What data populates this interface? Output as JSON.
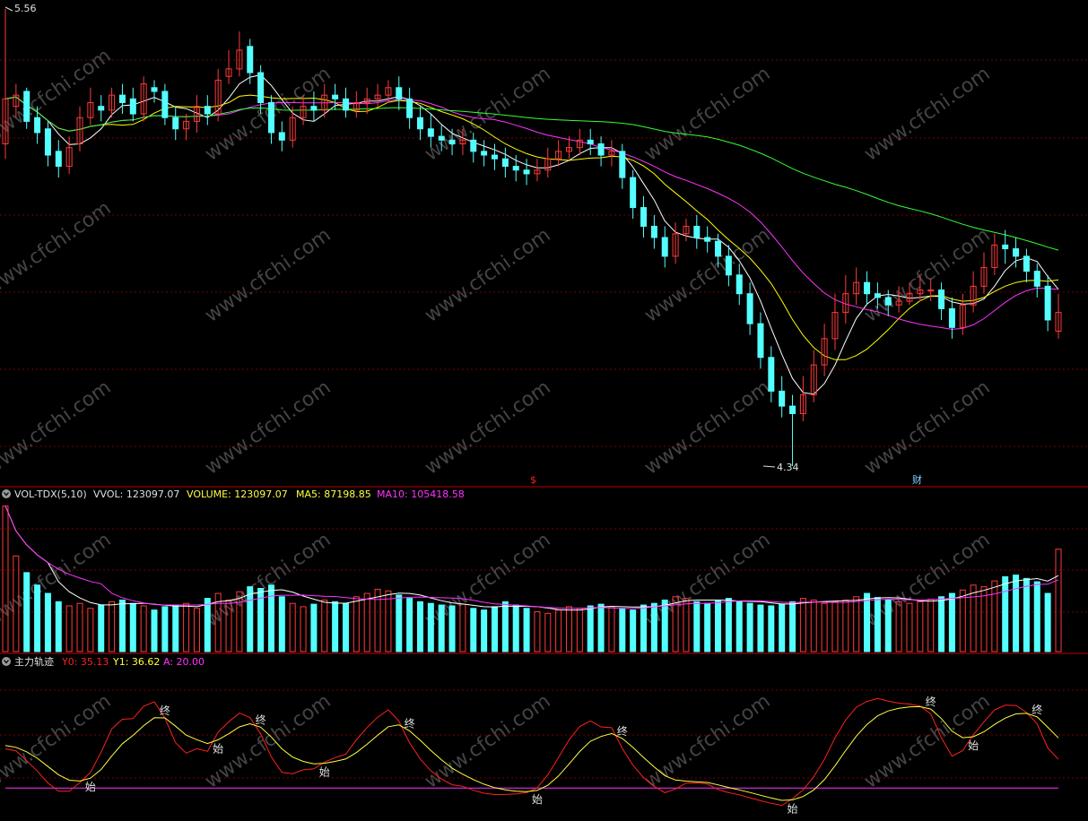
{
  "colors": {
    "up": "#ff3a3a",
    "down": "#54ffff",
    "ma_short": "#ffffff",
    "ma_mid": "#ffff00",
    "ma_long": "#ff33ff",
    "ma_slow": "#33ff33",
    "grid": "#7a0000",
    "separator": "#c00000",
    "vol_ma5": "#ffffff",
    "vol_ma10": "#ff33ff",
    "y0": "#ff2020",
    "y1": "#ffff40",
    "a_line": "#ff33ff",
    "text_white": "#e0e0e0",
    "text_yellow": "#ffff40",
    "text_magenta": "#ff33ff",
    "text_red": "#ff2020",
    "watermark": "#444444"
  },
  "watermark_text": "www.cfchi.com",
  "price_panel": {
    "high_marker": "5.56",
    "low_marker": "4.34",
    "event_s": "$",
    "event_cai": "财"
  },
  "volume_panel": {
    "name": "VOL-TDX(5,10)",
    "vvol": "VVOL: 123097.07",
    "volume": "VOLUME: 123097.07",
    "ma5": "MA5: 87198.85",
    "ma10": "MA10: 105418.58"
  },
  "indicator_panel": {
    "name": "主力轨迹",
    "y0": "Y0: 35.13",
    "y1": "Y1: 36.62",
    "a": "A: 20.00",
    "start_label": "始",
    "end_label": "终"
  },
  "chart_data": [
    {
      "type": "candlestick",
      "ylim": [
        4.34,
        5.56
      ],
      "description_keys": [
        "count",
        "open",
        "high",
        "low",
        "close"
      ],
      "count": 100,
      "close": [
        5.32,
        5.33,
        5.26,
        5.23,
        5.17,
        5.14,
        5.19,
        5.27,
        5.31,
        5.29,
        5.33,
        5.31,
        5.28,
        5.36,
        5.34,
        5.27,
        5.24,
        5.26,
        5.3,
        5.28,
        5.37,
        5.4,
        5.45,
        5.39,
        5.31,
        5.23,
        5.21,
        5.27,
        5.3,
        5.29,
        5.33,
        5.32,
        5.29,
        5.31,
        5.32,
        5.33,
        5.35,
        5.32,
        5.27,
        5.24,
        5.22,
        5.21,
        5.2,
        5.21,
        5.18,
        5.17,
        5.16,
        5.14,
        5.13,
        5.12,
        5.13,
        5.16,
        5.18,
        5.19,
        5.21,
        5.2,
        5.17,
        5.18,
        5.11,
        5.03,
        4.98,
        4.95,
        4.9,
        4.96,
        4.98,
        4.95,
        4.94,
        4.9,
        4.85,
        4.8,
        4.72,
        4.63,
        4.54,
        4.5,
        4.48,
        4.53,
        4.61,
        4.68,
        4.75,
        4.8,
        4.83,
        4.8,
        4.79,
        4.77,
        4.78,
        4.8,
        4.81,
        4.81,
        4.76,
        4.71,
        4.77,
        4.82,
        4.87,
        4.93,
        4.92,
        4.9,
        4.86,
        4.82,
        4.73,
        4.75
      ],
      "open": [
        5.2,
        5.3,
        5.34,
        5.27,
        5.24,
        5.18,
        5.14,
        5.2,
        5.27,
        5.3,
        5.29,
        5.33,
        5.32,
        5.28,
        5.35,
        5.34,
        5.27,
        5.24,
        5.26,
        5.3,
        5.28,
        5.38,
        5.4,
        5.46,
        5.39,
        5.31,
        5.23,
        5.21,
        5.27,
        5.3,
        5.29,
        5.33,
        5.32,
        5.29,
        5.31,
        5.32,
        5.33,
        5.35,
        5.32,
        5.27,
        5.24,
        5.22,
        5.21,
        5.2,
        5.21,
        5.18,
        5.17,
        5.16,
        5.14,
        5.13,
        5.12,
        5.13,
        5.16,
        5.18,
        5.19,
        5.21,
        5.2,
        5.17,
        5.18,
        5.11,
        5.03,
        4.98,
        4.95,
        4.9,
        4.96,
        4.98,
        4.95,
        4.94,
        4.9,
        4.85,
        4.8,
        4.72,
        4.63,
        4.54,
        4.5,
        4.48,
        4.53,
        4.61,
        4.68,
        4.75,
        4.8,
        4.83,
        4.8,
        4.79,
        4.77,
        4.78,
        4.8,
        4.81,
        4.81,
        4.76,
        4.71,
        4.77,
        4.82,
        4.87,
        4.93,
        4.92,
        4.9,
        4.86,
        4.82,
        4.7
      ],
      "high": [
        5.56,
        5.36,
        5.35,
        5.3,
        5.26,
        5.21,
        5.22,
        5.3,
        5.35,
        5.33,
        5.35,
        5.36,
        5.35,
        5.38,
        5.37,
        5.36,
        5.3,
        5.28,
        5.33,
        5.33,
        5.4,
        5.45,
        5.5,
        5.48,
        5.41,
        5.33,
        5.26,
        5.3,
        5.33,
        5.34,
        5.36,
        5.36,
        5.35,
        5.34,
        5.35,
        5.36,
        5.37,
        5.38,
        5.35,
        5.3,
        5.28,
        5.25,
        5.24,
        5.24,
        5.23,
        5.21,
        5.2,
        5.19,
        5.17,
        5.16,
        5.16,
        5.19,
        5.21,
        5.22,
        5.24,
        5.24,
        5.22,
        5.21,
        5.2,
        5.13,
        5.06,
        5.01,
        4.98,
        4.99,
        5.0,
        5.01,
        4.98,
        4.96,
        4.93,
        4.88,
        4.83,
        4.75,
        4.66,
        4.58,
        4.53,
        4.58,
        4.65,
        4.72,
        4.8,
        4.85,
        4.87,
        4.86,
        4.83,
        4.81,
        4.82,
        4.83,
        4.85,
        4.84,
        4.83,
        4.79,
        4.8,
        4.86,
        4.91,
        4.96,
        4.97,
        4.95,
        4.92,
        4.88,
        4.85,
        4.8
      ],
      "low": [
        5.16,
        5.27,
        5.24,
        5.2,
        5.14,
        5.11,
        5.12,
        5.18,
        5.25,
        5.26,
        5.27,
        5.28,
        5.26,
        5.26,
        5.31,
        5.25,
        5.21,
        5.21,
        5.23,
        5.25,
        5.26,
        5.36,
        5.38,
        5.36,
        5.28,
        5.2,
        5.18,
        5.19,
        5.25,
        5.26,
        5.27,
        5.29,
        5.27,
        5.27,
        5.28,
        5.3,
        5.31,
        5.29,
        5.24,
        5.21,
        5.19,
        5.18,
        5.17,
        5.17,
        5.15,
        5.14,
        5.13,
        5.11,
        5.1,
        5.09,
        5.1,
        5.11,
        5.14,
        5.16,
        5.17,
        5.17,
        5.14,
        5.14,
        5.08,
        5.0,
        4.95,
        4.92,
        4.87,
        4.88,
        4.94,
        4.92,
        4.91,
        4.87,
        4.82,
        4.77,
        4.69,
        4.6,
        4.51,
        4.47,
        4.34,
        4.46,
        4.51,
        4.58,
        4.65,
        4.72,
        4.77,
        4.77,
        4.76,
        4.74,
        4.75,
        4.77,
        4.78,
        4.78,
        4.73,
        4.68,
        4.69,
        4.75,
        4.8,
        4.85,
        4.88,
        4.87,
        4.83,
        4.79,
        4.7,
        4.68
      ]
    },
    {
      "type": "bar",
      "name": "VOLUME",
      "ylim": [
        0,
        180000
      ],
      "values": [
        175000,
        115000,
        95000,
        80000,
        70000,
        60000,
        55000,
        58000,
        52000,
        56000,
        60000,
        62000,
        58000,
        55000,
        50000,
        54000,
        56000,
        58000,
        52000,
        64000,
        70000,
        62000,
        72000,
        78000,
        76000,
        80000,
        66000,
        58000,
        54000,
        57000,
        62000,
        60000,
        58000,
        66000,
        70000,
        75000,
        73000,
        68000,
        64000,
        60000,
        58000,
        56000,
        55000,
        57000,
        52000,
        50000,
        54000,
        60000,
        56000,
        52000,
        48000,
        46000,
        50000,
        54000,
        52000,
        55000,
        57000,
        54000,
        52000,
        50000,
        56000,
        58000,
        62000,
        66000,
        64000,
        60000,
        58000,
        62000,
        64000,
        60000,
        58000,
        56000,
        55000,
        57000,
        60000,
        64000,
        62000,
        58000,
        60000,
        62000,
        66000,
        70000,
        65000,
        62000,
        60000,
        58000,
        60000,
        63000,
        66000,
        70000,
        74000,
        80000,
        78000,
        85000,
        90000,
        92000,
        88000,
        84000,
        70000,
        123097.07
      ],
      "ma5_last": 87198.85,
      "ma10_last": 105418.58,
      "vvol_last": 123097.07
    },
    {
      "type": "line",
      "name": "主力轨迹",
      "ylim": [
        0,
        100
      ],
      "series": [
        {
          "name": "Y0",
          "last": 35.13
        },
        {
          "name": "Y1",
          "last": 36.62
        },
        {
          "name": "A",
          "last": 20.0
        }
      ]
    }
  ]
}
